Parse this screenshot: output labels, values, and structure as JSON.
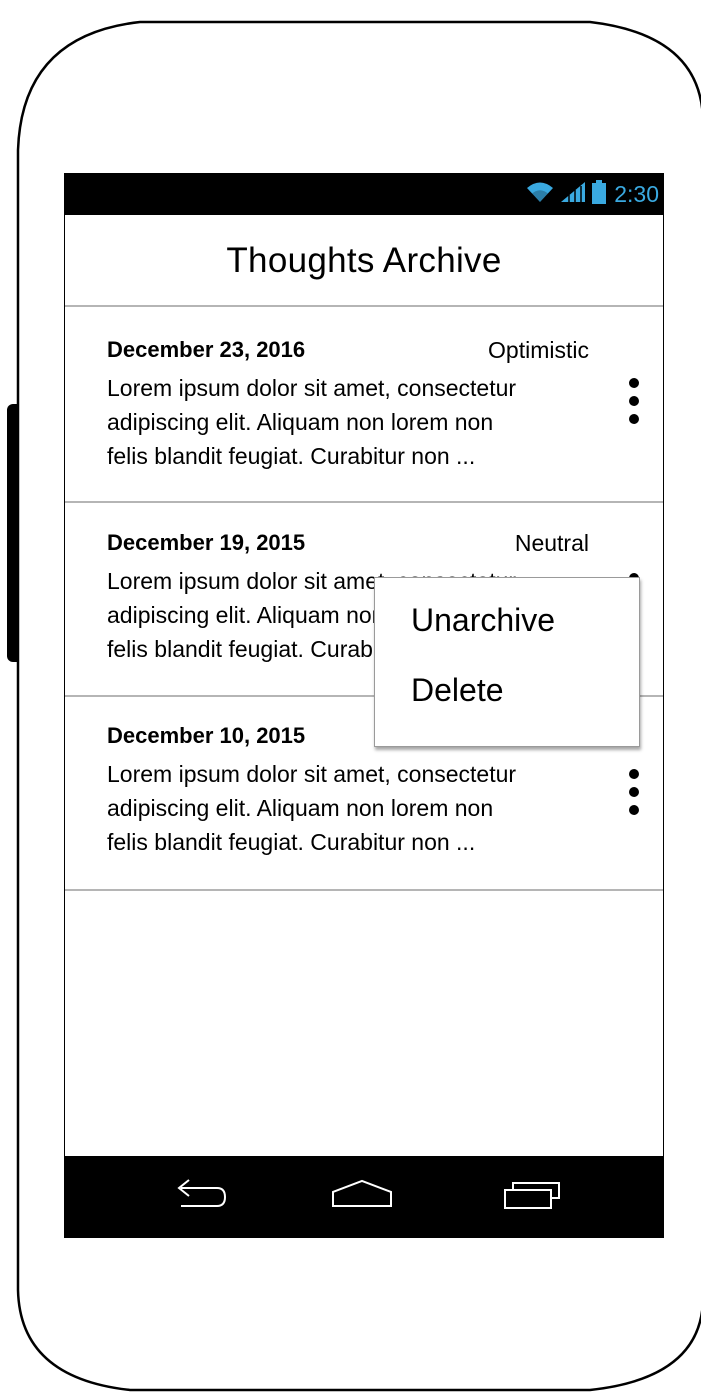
{
  "status_bar": {
    "time": "2:30",
    "icons": [
      "wifi-icon",
      "signal-icon",
      "battery-icon"
    ],
    "accent_color": "#3aa9e0"
  },
  "app": {
    "title": "Thoughts Archive"
  },
  "entries": [
    {
      "date": "December 23, 2016",
      "mood": "Optimistic",
      "body": "Lorem ipsum dolor sit amet, consectetur\nadipiscing elit. Aliquam non lorem non\nfelis blandit feugiat. Curabitur non ..."
    },
    {
      "date": "December 19, 2015",
      "mood": "Neutral",
      "body": "Lorem ipsum dolor sit amet, consectetur\nadipiscing elit. Aliquam non lorem non\nfelis blandit feugiat. Curabitur non ..."
    },
    {
      "date": "December 10, 2015",
      "mood": "",
      "body": "Lorem ipsum dolor sit amet, consectetur\nadipiscing elit. Aliquam non lorem non\nfelis blandit feugiat. Curabitur non ..."
    }
  ],
  "context_menu": {
    "items": [
      "Unarchive",
      "Delete"
    ]
  },
  "nav_bar": {
    "icons": [
      "back-icon",
      "home-icon",
      "recents-icon"
    ]
  }
}
